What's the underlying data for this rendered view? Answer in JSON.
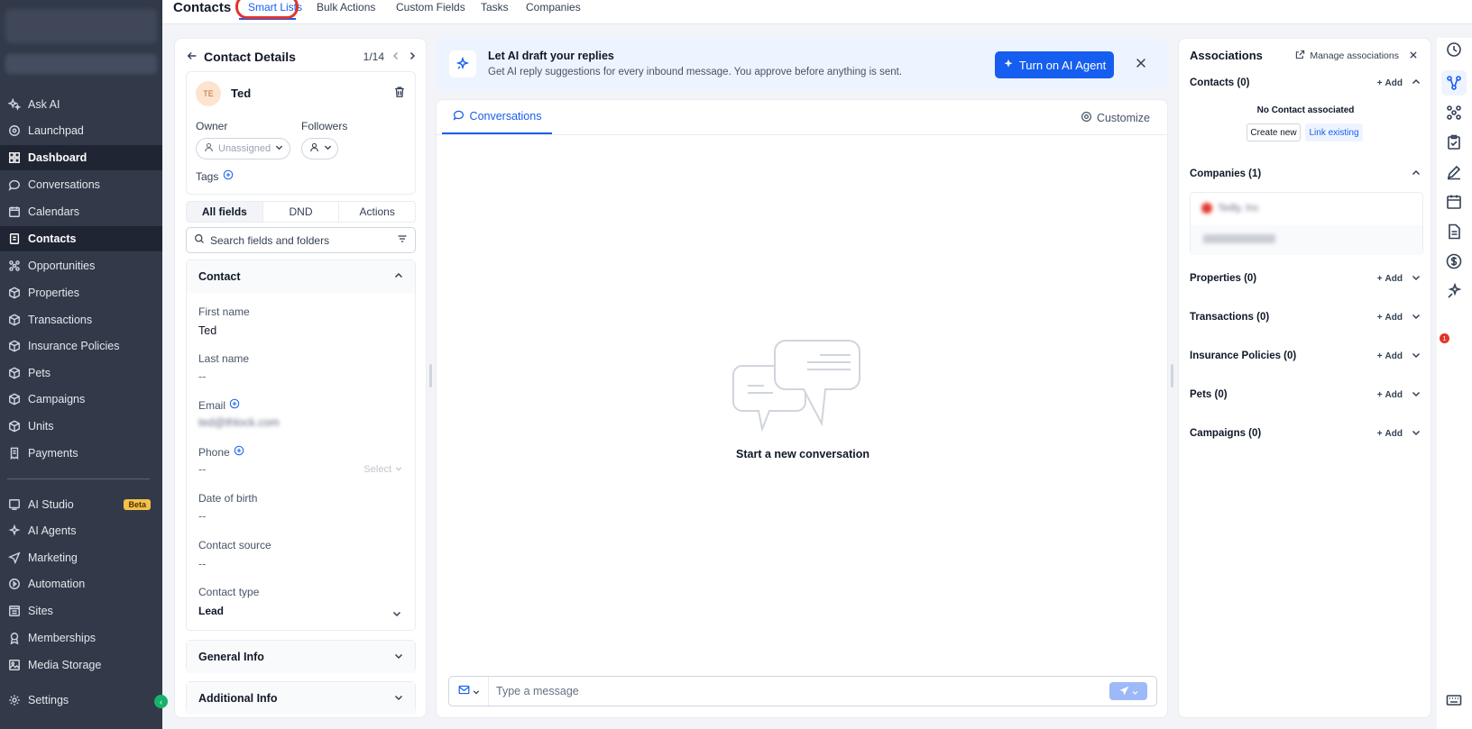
{
  "top": {
    "page_title": "Contacts",
    "tabs": [
      "Smart Lists",
      "Bulk Actions",
      "Custom Fields",
      "Tasks",
      "Companies"
    ]
  },
  "sidebar": {
    "items": [
      {
        "label": "Ask AI",
        "icon": "sparkle-icon"
      },
      {
        "label": "Launchpad",
        "icon": "rocket-icon"
      },
      {
        "label": "Dashboard",
        "icon": "grid-icon"
      },
      {
        "label": "Conversations",
        "icon": "chat-icon"
      },
      {
        "label": "Calendars",
        "icon": "calendar-icon"
      },
      {
        "label": "Contacts",
        "icon": "contact-book-icon"
      },
      {
        "label": "Opportunities",
        "icon": "funnel-icon"
      },
      {
        "label": "Properties",
        "icon": "box-icon"
      },
      {
        "label": "Transactions",
        "icon": "box-icon"
      },
      {
        "label": "Insurance Policies",
        "icon": "box-icon"
      },
      {
        "label": "Pets",
        "icon": "box-icon"
      },
      {
        "label": "Campaigns",
        "icon": "box-icon"
      },
      {
        "label": "Units",
        "icon": "box-icon"
      },
      {
        "label": "Payments",
        "icon": "receipt-icon"
      },
      {
        "label": "AI Studio",
        "icon": "studio-icon"
      },
      {
        "label": "AI Agents",
        "icon": "sparkle-icon"
      },
      {
        "label": "Marketing",
        "icon": "send-icon"
      },
      {
        "label": "Automation",
        "icon": "automation-icon"
      },
      {
        "label": "Sites",
        "icon": "sites-icon"
      },
      {
        "label": "Memberships",
        "icon": "award-icon"
      },
      {
        "label": "Media Storage",
        "icon": "image-icon"
      },
      {
        "label": "Settings",
        "icon": "gear-icon"
      }
    ],
    "beta_label": "Beta"
  },
  "contact_details": {
    "title": "Contact Details",
    "pager": "1/14",
    "initials": "TE",
    "name": "Ted",
    "owner_label": "Owner",
    "owner_value": "Unassigned",
    "followers_label": "Followers",
    "tags_label": "Tags",
    "segments": [
      "All fields",
      "DND",
      "Actions"
    ],
    "search_placeholder": "Search fields and folders",
    "contact_section": "Contact",
    "fields": {
      "first_name_label": "First name",
      "first_name_value": "Ted",
      "last_name_label": "Last name",
      "last_name_value": "--",
      "email_label": "Email",
      "email_value": "ted@thlock.com",
      "phone_label": "Phone",
      "phone_value": "--",
      "phone_select": "Select",
      "dob_label": "Date of birth",
      "dob_value": "--",
      "source_label": "Contact source",
      "source_value": "--",
      "type_label": "Contact type",
      "type_value": "Lead"
    },
    "general_info": "General Info",
    "additional_info": "Additional Info"
  },
  "banner": {
    "title": "Let AI draft your replies",
    "subtitle": "Get AI reply suggestions for every inbound message. You approve before anything is sent.",
    "button": "Turn on AI Agent"
  },
  "conversation": {
    "tab": "Conversations",
    "customize": "Customize",
    "empty": "Start a new conversation",
    "composer_placeholder": "Type a message"
  },
  "associations": {
    "title": "Associations",
    "manage": "Manage associations",
    "add": "Add",
    "contacts_label": "Contacts (0)",
    "no_contact": "No Contact associated",
    "create_new": "Create new",
    "link_existing": "Link existing",
    "companies_label": "Companies (1)",
    "company_name": "Tedly, Inc",
    "company_sub": "Primary Company",
    "properties_label": "Properties (0)",
    "transactions_label": "Transactions (0)",
    "insurance_label": "Insurance Policies (0)",
    "pets_label": "Pets (0)",
    "campaigns_label": "Campaigns (0)"
  },
  "rail": {
    "badge": "1"
  },
  "colors": {
    "sidebar_bg": "#323a4a",
    "accent": "#155eef",
    "highlight": "#e0352b"
  }
}
